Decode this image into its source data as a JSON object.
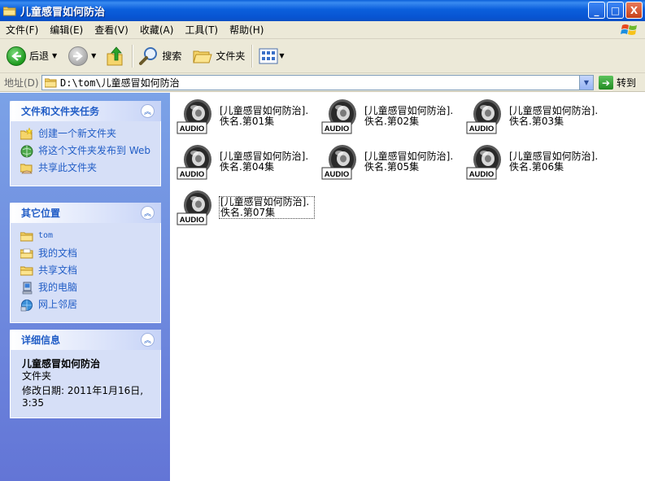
{
  "window": {
    "title": "儿童感冒如何防治",
    "minimize": "_",
    "maximize": "□",
    "close": "X"
  },
  "menu": [
    "文件(F)",
    "编辑(E)",
    "查看(V)",
    "收藏(A)",
    "工具(T)",
    "帮助(H)"
  ],
  "toolbar": {
    "back": "后退",
    "search": "搜索",
    "folders": "文件夹"
  },
  "address": {
    "label": "地址(D)",
    "path_prefix": "D:\\tom\\",
    "path_folder": "儿童感冒如何防治",
    "go": "转到"
  },
  "tasks": {
    "title": "文件和文件夹任务",
    "items": [
      {
        "label": "创建一个新文件夹"
      },
      {
        "label": "将这个文件夹发布到 Web"
      },
      {
        "label": "共享此文件夹"
      }
    ]
  },
  "places": {
    "title": "其它位置",
    "items": [
      {
        "label": "tom"
      },
      {
        "label": "我的文档"
      },
      {
        "label": "共享文档"
      },
      {
        "label": "我的电脑"
      },
      {
        "label": "网上邻居"
      }
    ]
  },
  "details": {
    "title": "详细信息",
    "name": "儿童感冒如何防治",
    "type": "文件夹",
    "modified": "修改日期: 2011年1月16日, 3:35"
  },
  "files": [
    {
      "line1": "[儿童感冒如何防治].",
      "line2": "佚名.第01集"
    },
    {
      "line1": "[儿童感冒如何防治].",
      "line2": "佚名.第02集"
    },
    {
      "line1": "[儿童感冒如何防治].",
      "line2": "佚名.第03集"
    },
    {
      "line1": "[儿童感冒如何防治].",
      "line2": "佚名.第04集"
    },
    {
      "line1": "[儿童感冒如何防治].",
      "line2": "佚名.第05集"
    },
    {
      "line1": "[儿童感冒如何防治].",
      "line2": "佚名.第06集"
    },
    {
      "line1": "[儿童感冒如何防治].",
      "line2": "佚名.第07集"
    }
  ],
  "icon_label": "AUDIO",
  "colors": {
    "title_bar": "#0b5fdc",
    "task_link": "#215dc6",
    "left_panel": "#7ba2e7",
    "chrome": "#ece9d8"
  }
}
